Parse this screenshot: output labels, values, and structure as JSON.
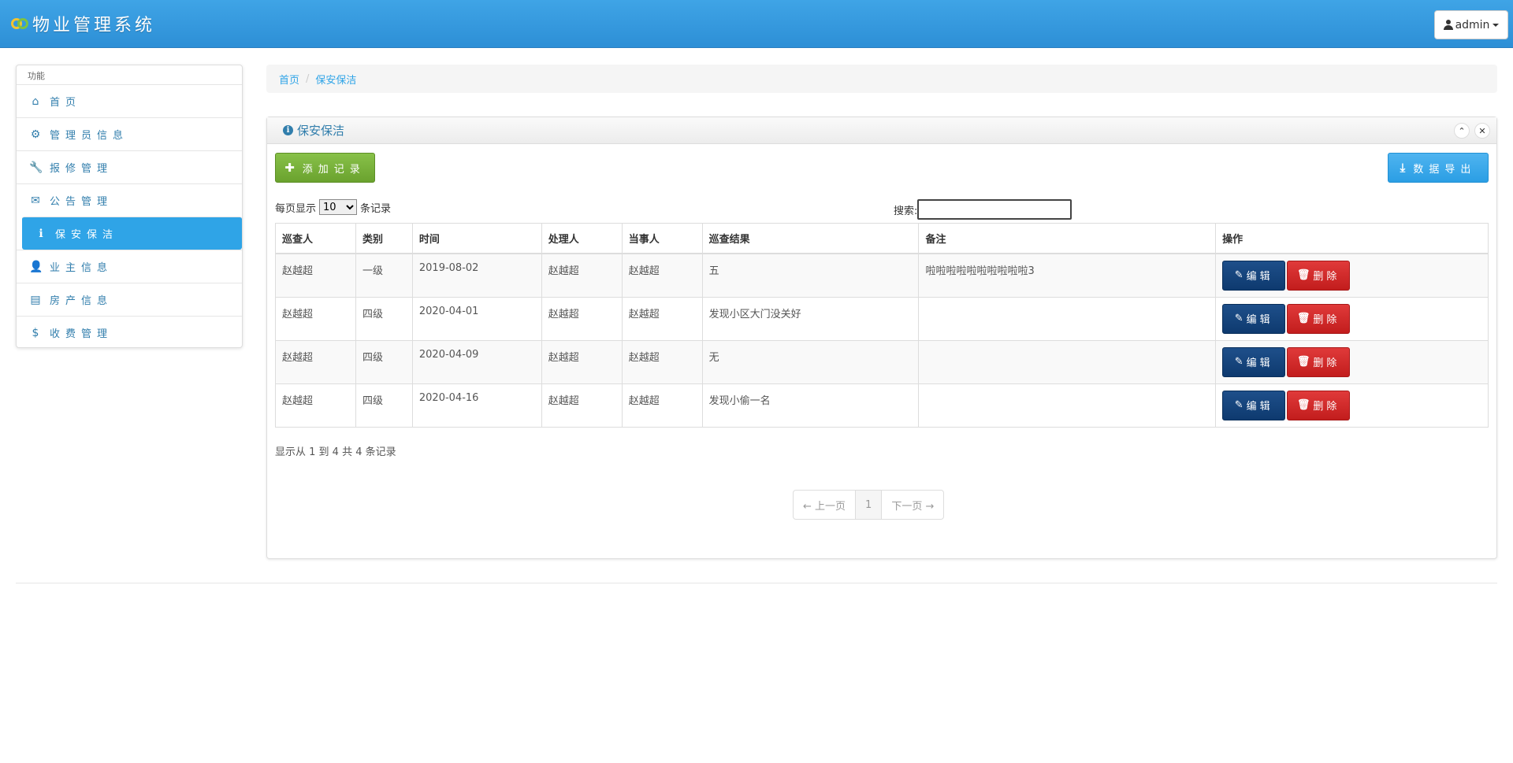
{
  "app": {
    "title": "物业管理系统"
  },
  "user": {
    "name": "admin"
  },
  "sidebar": {
    "heading": "功能",
    "items": [
      {
        "label": "首页",
        "icon": "home-icon",
        "glyph": "⌂"
      },
      {
        "label": "管理员信息",
        "icon": "gear-icon",
        "glyph": "⚙"
      },
      {
        "label": "报修管理",
        "icon": "wrench-icon",
        "glyph": "🔧"
      },
      {
        "label": "公告管理",
        "icon": "envelope-icon",
        "glyph": "✉"
      },
      {
        "label": "保安保洁",
        "icon": "info-icon",
        "glyph": "ℹ"
      },
      {
        "label": "业主信息",
        "icon": "user-icon",
        "glyph": "👤"
      },
      {
        "label": "房产信息",
        "icon": "list-icon",
        "glyph": "▤"
      },
      {
        "label": "收费管理",
        "icon": "dollar-icon",
        "glyph": "$"
      }
    ],
    "active_index": 4
  },
  "breadcrumb": {
    "home": "首页",
    "current": "保安保洁"
  },
  "panel": {
    "title": "保安保洁"
  },
  "toolbar": {
    "add_label": "添加记录",
    "export_label": "数据导出"
  },
  "length": {
    "prefix": "每页显示",
    "value": "10",
    "suffix": "条记录",
    "options": [
      "10"
    ]
  },
  "search": {
    "label": "搜索:",
    "value": ""
  },
  "table": {
    "headers": [
      "巡查人",
      "类别",
      "时间",
      "处理人",
      "当事人",
      "巡查结果",
      "备注",
      "操作"
    ],
    "rows": [
      [
        "赵越超",
        "一级",
        "2019-08-02",
        "赵越超",
        "赵越超",
        "五",
        "啦啦啦啦啦啦啦啦啦啦3"
      ],
      [
        "赵越超",
        "四级",
        "2020-04-01",
        "赵越超",
        "赵越超",
        "发现小区大门没关好",
        ""
      ],
      [
        "赵越超",
        "四级",
        "2020-04-09",
        "赵越超",
        "赵越超",
        "无",
        ""
      ],
      [
        "赵越超",
        "四级",
        "2020-04-16",
        "赵越超",
        "赵越超",
        "发现小偷一名",
        ""
      ]
    ],
    "edit_label": "编辑",
    "delete_label": "删除"
  },
  "footer": {
    "info": "显示从 1 到 4 共 4 条记录"
  },
  "pager": {
    "prev": "← 上一页",
    "current": "1",
    "next": "下一页 →"
  }
}
